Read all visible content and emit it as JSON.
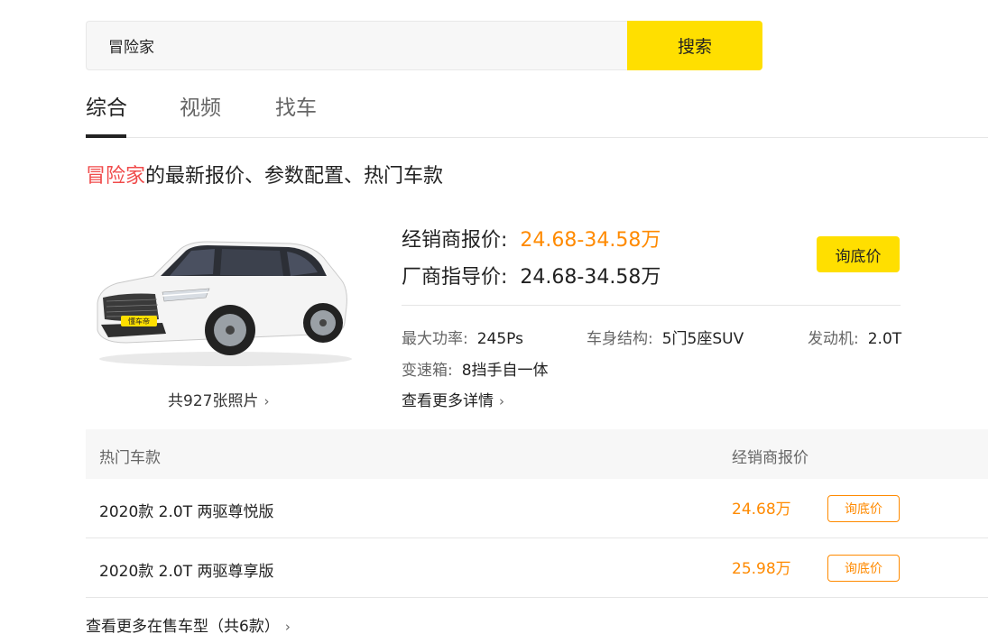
{
  "search": {
    "value": "冒险家",
    "button_label": "搜索"
  },
  "tabs": [
    {
      "label": "综合",
      "active": true
    },
    {
      "label": "视频",
      "active": false
    },
    {
      "label": "找车",
      "active": false
    }
  ],
  "heading": {
    "keyword": "冒险家",
    "suffix": "的最新报价、参数配置、热门车款"
  },
  "car": {
    "image_badge": "懂车帝",
    "photo_count": "共927张照片",
    "dealer_price_label": "经销商报价:",
    "dealer_price": "24.68-34.58万",
    "msrp_label": "厂商指导价:",
    "msrp": "24.68-34.58万",
    "inquiry_label": "询底价",
    "specs": {
      "power_label": "最大功率:",
      "power": "245Ps",
      "body_label": "车身结构:",
      "body": "5门5座SUV",
      "engine_label": "发动机:",
      "engine": "2.0T",
      "gearbox_label": "变速箱:",
      "gearbox": "8挡手自一体"
    },
    "more_details": "查看更多详情"
  },
  "models_table": {
    "col_name": "热门车款",
    "col_price": "经销商报价",
    "rows": [
      {
        "name": "2020款 2.0T 两驱尊悦版",
        "price": "24.68万",
        "button": "询底价"
      },
      {
        "name": "2020款 2.0T 两驱尊享版",
        "price": "25.98万",
        "button": "询底价"
      }
    ]
  },
  "view_all": "查看更多在售车型（共6款）",
  "colors": {
    "accent_yellow": "#ffdf00",
    "price_orange": "#ff8a00",
    "keyword_red": "#f04b4b"
  }
}
